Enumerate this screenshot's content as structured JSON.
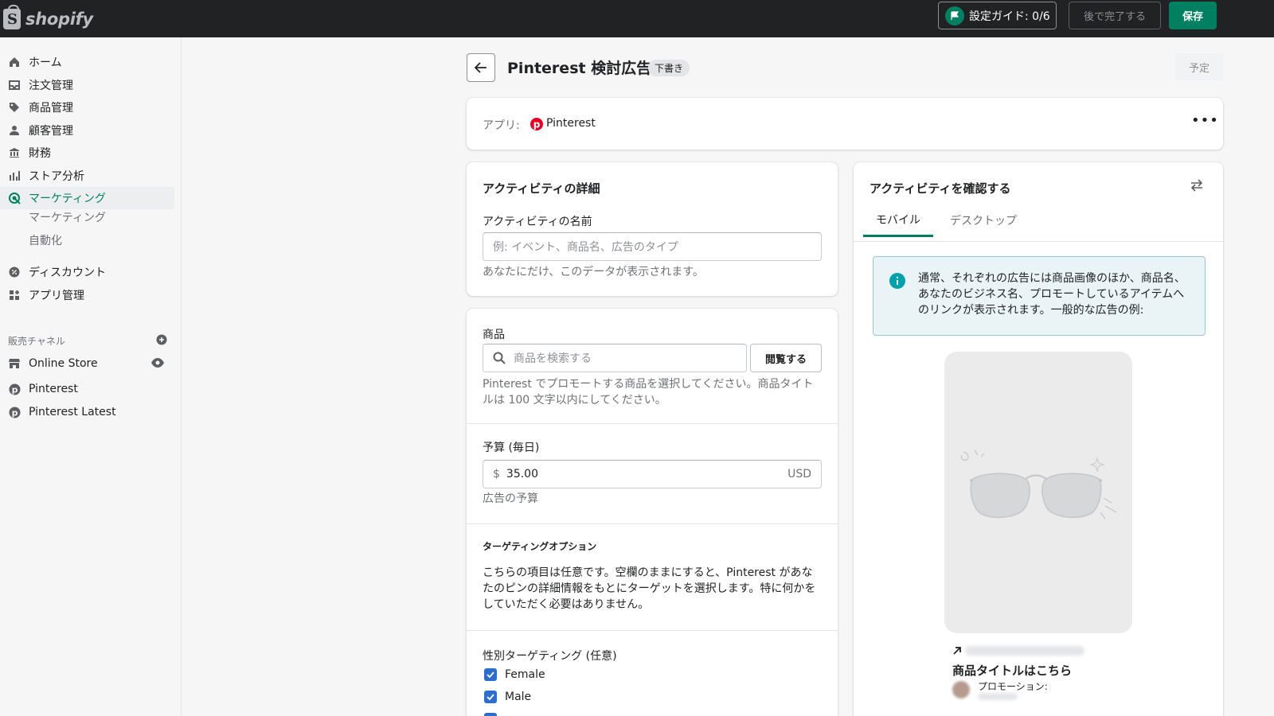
{
  "topbar": {
    "logo_text": "shopify",
    "setup_guide": "設定ガイド: 0/6",
    "finish_later": "後で完了する",
    "save": "保存"
  },
  "sidebar": {
    "items": [
      {
        "label": "ホーム",
        "icon": "home-icon"
      },
      {
        "label": "注文管理",
        "icon": "inbox-icon"
      },
      {
        "label": "商品管理",
        "icon": "tag-icon"
      },
      {
        "label": "顧客管理",
        "icon": "person-icon"
      },
      {
        "label": "財務",
        "icon": "bank-icon"
      },
      {
        "label": "ストア分析",
        "icon": "bar-chart-icon"
      },
      {
        "label": "マーケティング",
        "icon": "target-icon"
      }
    ],
    "sub_items": [
      "マーケティング",
      "自動化"
    ],
    "items2": [
      {
        "label": "ディスカウント",
        "icon": "discount-icon"
      },
      {
        "label": "アプリ管理",
        "icon": "apps-icon"
      }
    ],
    "channels_header": "販売チャネル",
    "channels": [
      {
        "label": "Online Store",
        "icon": "store-icon"
      },
      {
        "label": "Pinterest",
        "icon": "pinterest-icon"
      },
      {
        "label": "Pinterest Latest",
        "icon": "pinterest-icon"
      }
    ]
  },
  "page": {
    "title": "Pinterest 検討広告",
    "badge": "下書き",
    "schedule": "予定"
  },
  "app_card": {
    "label": "アプリ:",
    "app_name": "Pinterest"
  },
  "details": {
    "heading": "アクティビティの詳細",
    "name_label": "アクティビティの名前",
    "name_placeholder": "例: イベント、商品名、広告のタイプ",
    "name_help": "あなたにだけ、このデータが表示されます。"
  },
  "product": {
    "label": "商品",
    "search_placeholder": "商品を検索する",
    "browse": "閲覧する",
    "help": "Pinterest でプロモートする商品を選択してください。商品タイトルは 100 文字以内にしてください。"
  },
  "budget": {
    "label": "予算 (毎日)",
    "prefix": "$",
    "value": "35.00",
    "suffix": "USD",
    "help": "広告の予算"
  },
  "targeting": {
    "heading": "ターゲティングオプション",
    "text": "こちらの項目は任意です。空欄のままにすると、Pinterest があなたのピンの詳細情報をもとにターゲットを選択します。特に何かをしていただく必要はありません。"
  },
  "gender": {
    "label": "性別ターゲティング (任意)",
    "options": [
      {
        "label": "Female",
        "checked": true
      },
      {
        "label": "Male",
        "checked": true
      }
    ]
  },
  "preview": {
    "heading": "アクティビティを確認する",
    "tabs": [
      "モバイル",
      "デスクトップ"
    ],
    "info": "通常、それぞれの広告には商品画像のほか、商品名、あなたのビジネス名、プロモートしているアイテムへのリンクが表示されます。一般的な広告の例:",
    "product_title": "商品タイトルはこちら",
    "promoted_by": "プロモーション:"
  },
  "colors": {
    "accent": "#008060",
    "topbar": "#202223",
    "checkbox": "#2c6ecb",
    "info_bg": "#eaf4f7",
    "info_icon": "#00a0ac",
    "pinterest": "#e60023"
  }
}
